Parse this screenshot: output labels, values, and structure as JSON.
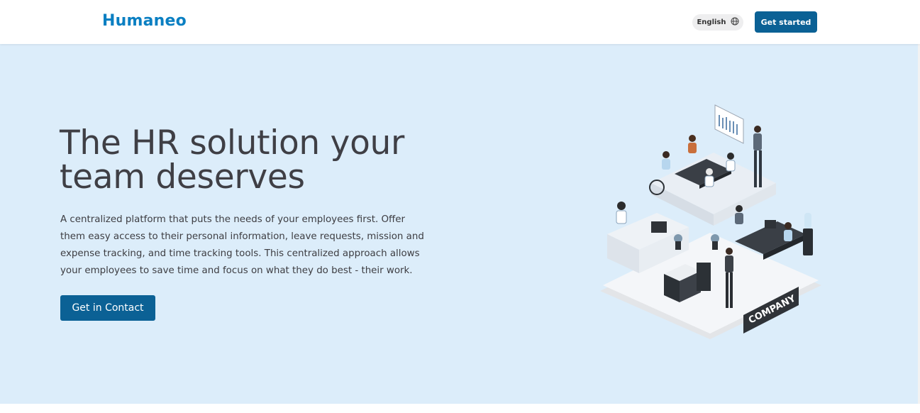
{
  "header": {
    "logo": "Humaneo",
    "language_label": "English",
    "get_started_label": "Get started"
  },
  "hero": {
    "headline_line1": "The HR solution your",
    "headline_line2": "team deserves",
    "description": "A centralized platform that puts the needs of your employees first. Offer them easy access to their personal information, leave requests, mission and expense tracking, and time tracking tools. This centralized approach allows your employees to save time and focus on what they do best - their work.",
    "contact_label": "Get in Contact",
    "illustration_sign": "COMPANY"
  },
  "colors": {
    "brand": "#0a7fc2",
    "button": "#0b6195",
    "hero_bg": "#dcedfa",
    "text": "#3f3f45"
  },
  "icons": [
    "globe-icon"
  ]
}
